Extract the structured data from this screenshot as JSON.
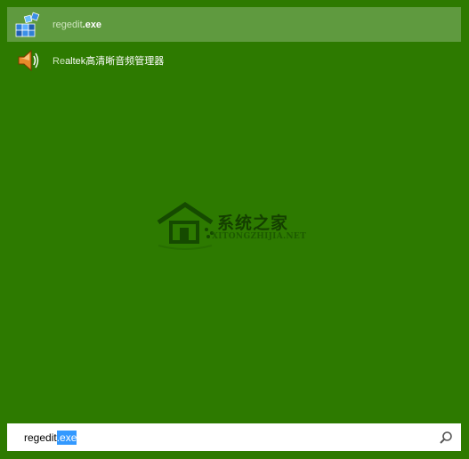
{
  "results": [
    {
      "icon": "registry-editor-icon",
      "match_text": "regedit",
      "rest_text": ".exe",
      "selected": true
    },
    {
      "icon": "speaker-icon",
      "match_text": "Re",
      "rest_text": "altek高清晰音频管理器",
      "selected": false
    }
  ],
  "watermark": {
    "title": "系统之家",
    "subtitle": "XITONGZHIJIA.NET"
  },
  "search": {
    "typed_value": "regedit",
    "autocomplete_value": ".exe",
    "button_icon": "search-icon"
  },
  "colors": {
    "background": "#2d7a00",
    "selected_row": "#5f9a3f",
    "selection_highlight": "#3399ff"
  }
}
